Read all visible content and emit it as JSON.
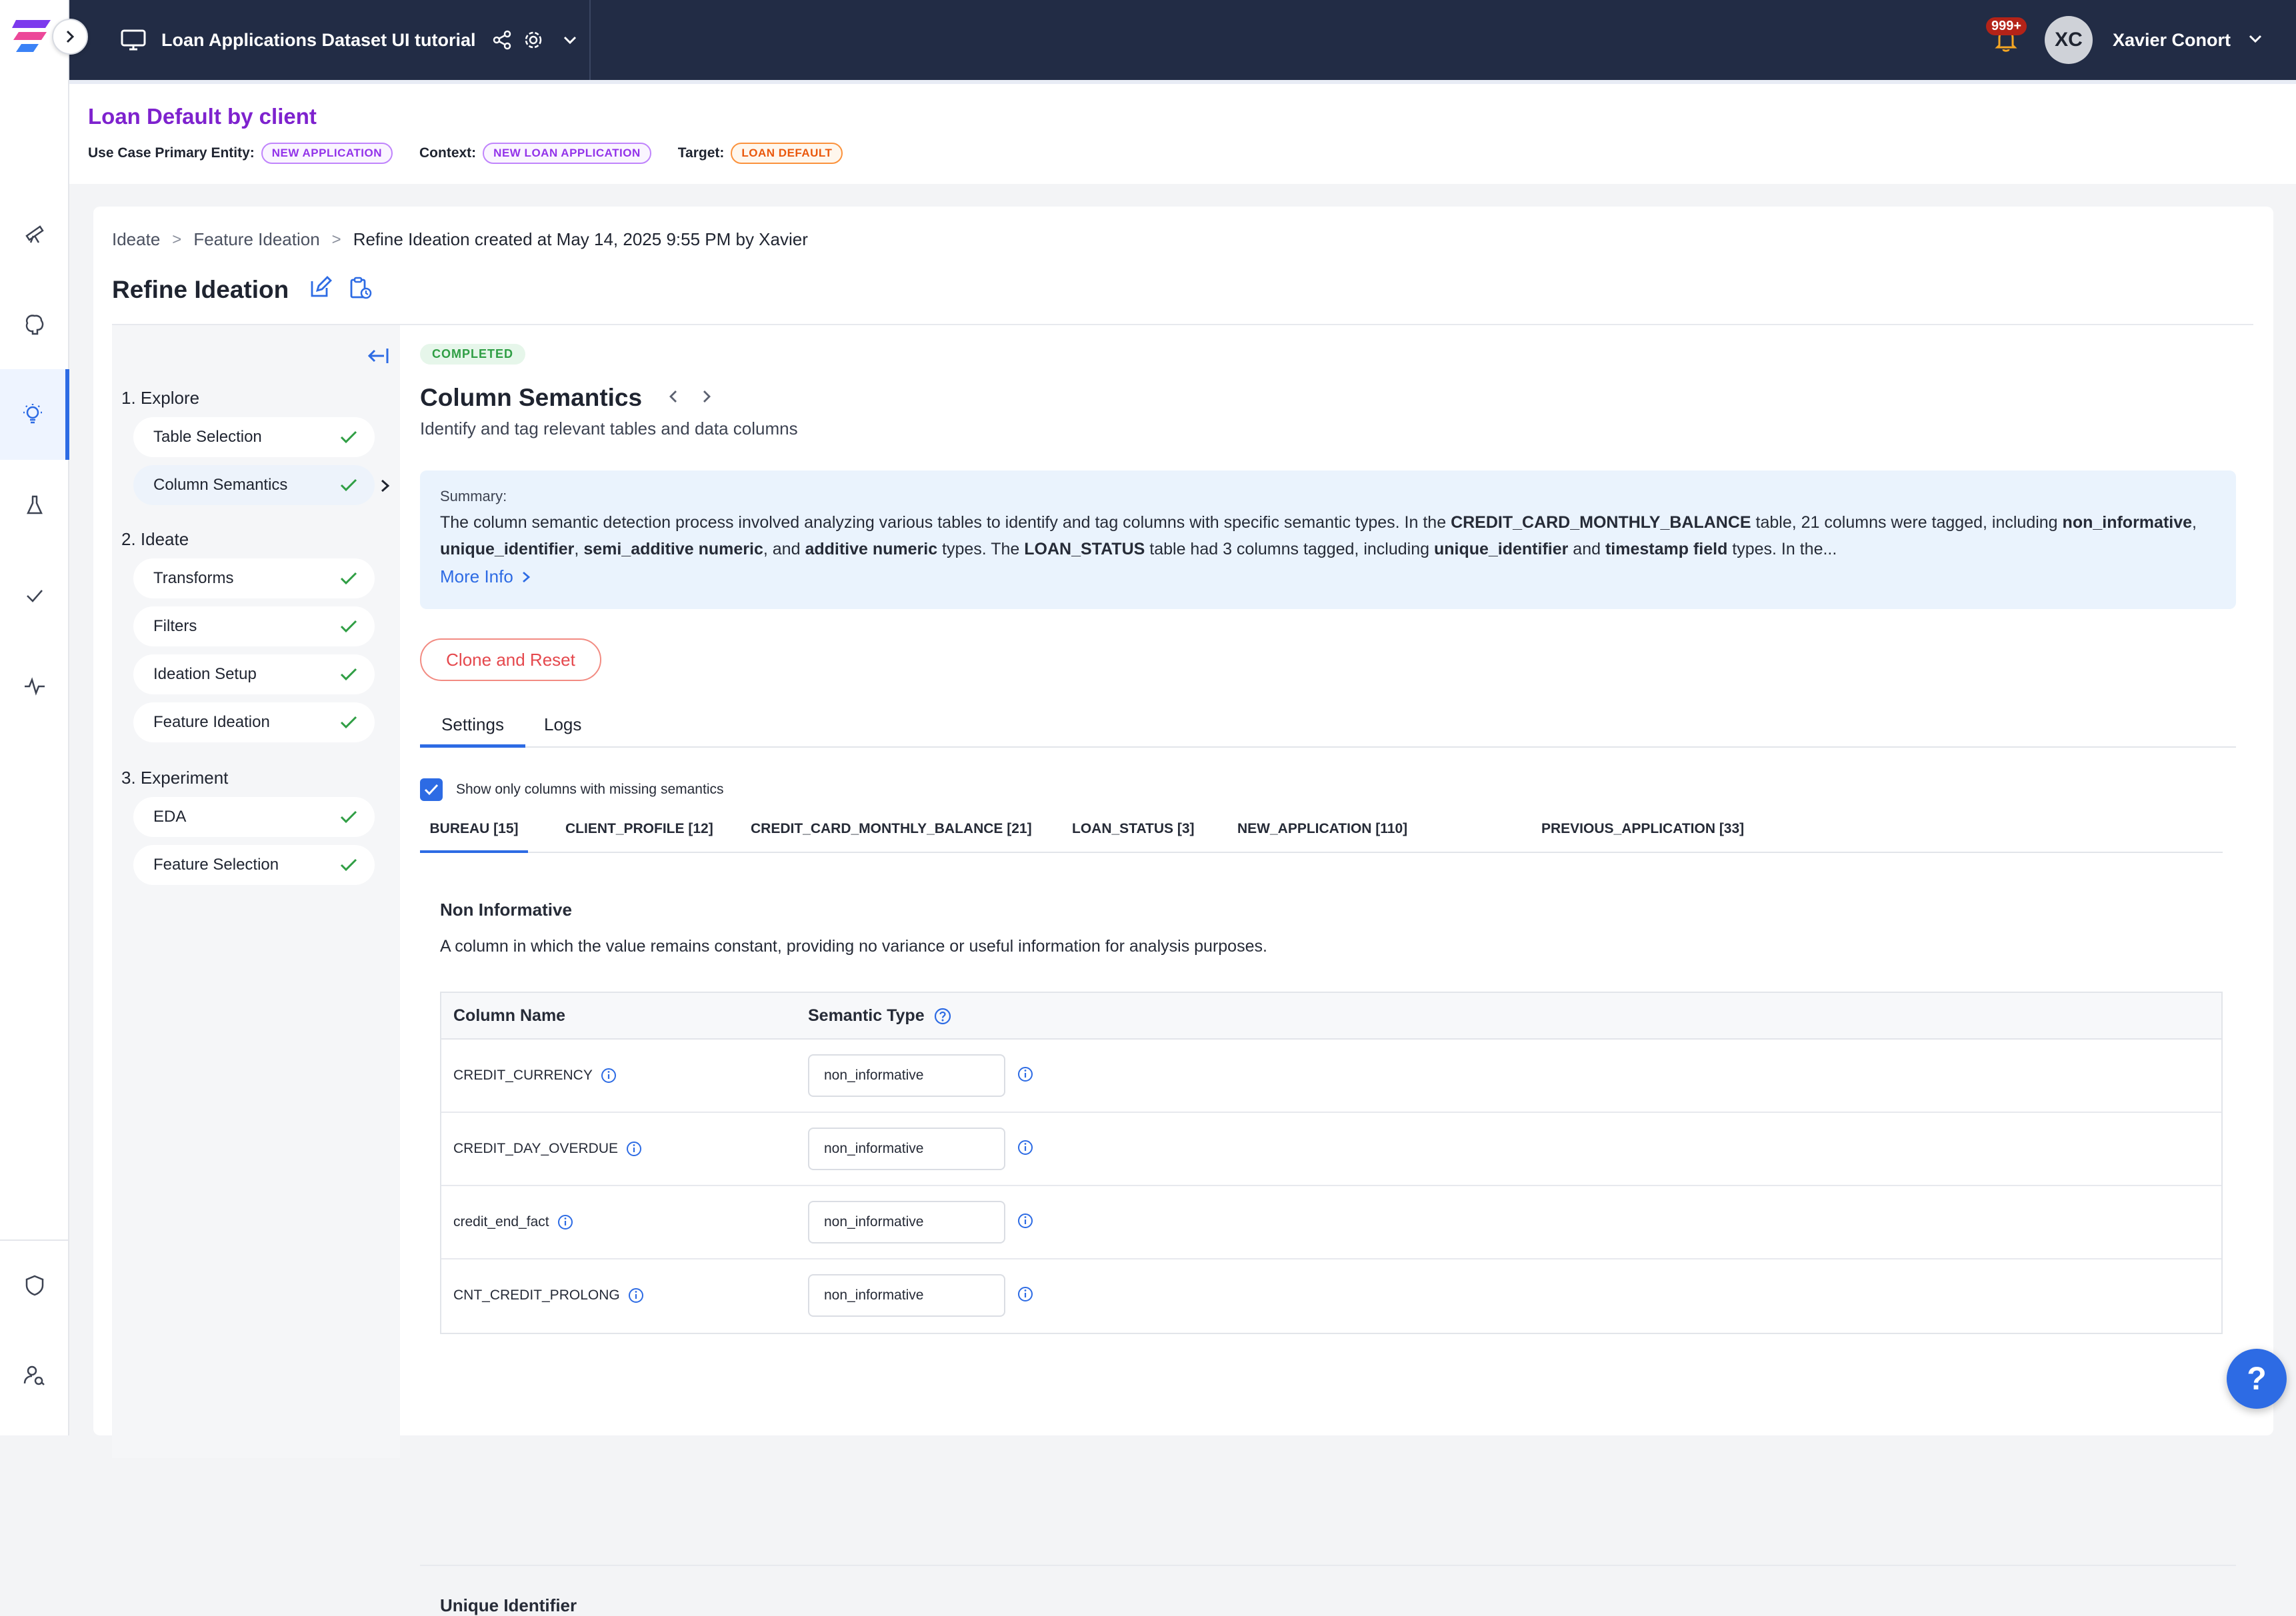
{
  "topbar": {
    "project_title": "Loan Applications Dataset UI tutorial",
    "notification_count": "999+",
    "user_initials": "XC",
    "user_name": "Xavier Conort"
  },
  "use_case": {
    "title": "Loan Default by client",
    "primary_entity_label": "Use Case Primary Entity:",
    "primary_entity_value": "NEW APPLICATION",
    "context_label": "Context:",
    "context_value": "NEW LOAN APPLICATION",
    "target_label": "Target:",
    "target_value": "LOAN DEFAULT"
  },
  "breadcrumb": {
    "items": [
      "Ideate",
      "Feature Ideation"
    ],
    "separator": ">",
    "current": "Refine Ideation created at May 14, 2025 9:55 PM by Xavier"
  },
  "page": {
    "title": "Refine Ideation"
  },
  "steps": {
    "sections": [
      {
        "label": "1. Explore",
        "items": [
          "Table Selection",
          "Column Semantics"
        ]
      },
      {
        "label": "2. Ideate",
        "items": [
          "Transforms",
          "Filters",
          "Ideation Setup",
          "Feature Ideation"
        ]
      },
      {
        "label": "3. Experiment",
        "items": [
          "EDA",
          "Feature Selection"
        ]
      }
    ]
  },
  "content": {
    "status": "COMPLETED",
    "title": "Column Semantics",
    "subtitle": "Identify and tag relevant tables and data columns",
    "summary_label": "Summary:",
    "summary_parts": {
      "p1": "The column semantic detection process involved analyzing various tables to identify and tag columns with specific semantic types. In the ",
      "b1": "CREDIT_CARD_MONTHLY_BALANCE",
      "p2": " table, 21 columns were tagged, including ",
      "b2": "non_informative",
      "p3": ", ",
      "b3": "unique_identifier",
      "p4": ", ",
      "b4": "semi_additive numeric",
      "p5": ", and ",
      "b5": "additive numeric",
      "p6": " types. The ",
      "b6": "LOAN_STATUS",
      "p7": " table had 3 columns tagged, including ",
      "b7": "unique_identifier",
      "p8": " and ",
      "b8": "timestamp field",
      "p9": " types. In the..."
    },
    "more_info": "More Info",
    "clone_reset": "Clone and Reset",
    "tabs": [
      "Settings",
      "Logs"
    ],
    "checkbox_label": "Show only columns with missing semantics",
    "table_tabs": [
      "BUREAU [15]",
      "CLIENT_PROFILE [12]",
      "CREDIT_CARD_MONTHLY_BALANCE [21]",
      "LOAN_STATUS [3]",
      "NEW_APPLICATION [110]",
      "PREVIOUS_APPLICATION [33]"
    ],
    "group1_title": "Non Informative",
    "group1_desc": "A column in which the value remains constant, providing no variance or useful information for analysis purposes.",
    "table_headers": {
      "col_name": "Column Name",
      "sem_type": "Semantic Type"
    },
    "rows": [
      {
        "name": "CREDIT_CURRENCY",
        "type": "non_informative"
      },
      {
        "name": "CREDIT_DAY_OVERDUE",
        "type": "non_informative"
      },
      {
        "name": "credit_end_fact",
        "type": "non_informative"
      },
      {
        "name": "CNT_CREDIT_PROLONG",
        "type": "non_informative"
      }
    ],
    "group2_title": "Unique Identifier"
  },
  "help": "?",
  "colors": {
    "accent": "#2d6be4",
    "topbar": "#222c45",
    "usecase_title": "#7e22ce",
    "success": "#2f9e44",
    "danger": "#e5484d"
  }
}
